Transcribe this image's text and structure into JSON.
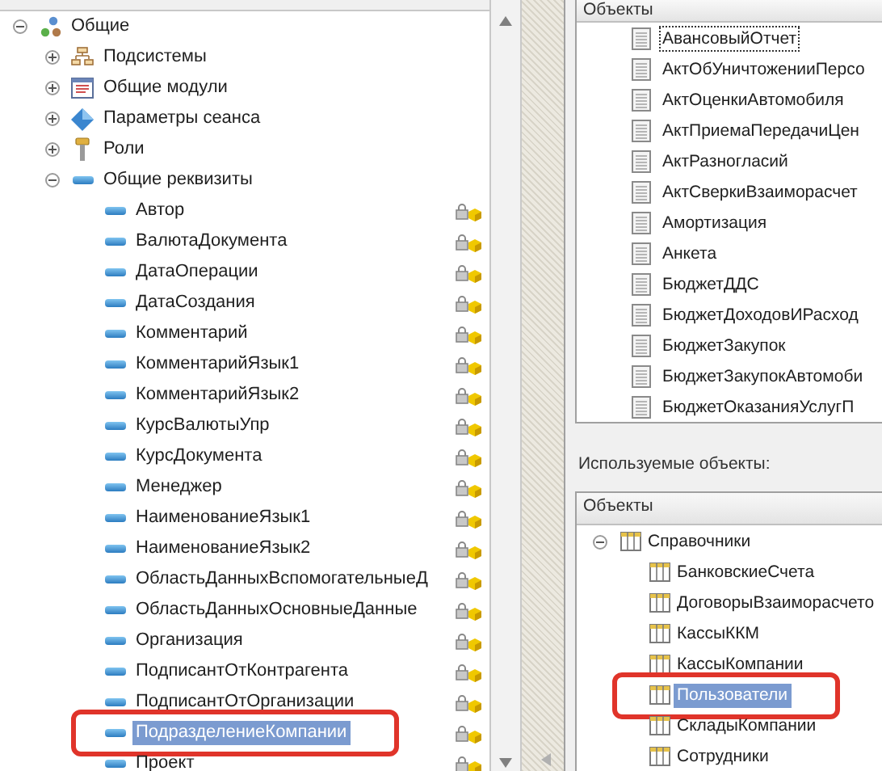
{
  "tree": [
    {
      "label": "Общие",
      "kind": "common",
      "expanded": true,
      "children": [
        {
          "label": "Подсистемы",
          "kind": "subsystems",
          "expanded": false
        },
        {
          "label": "Общие модули",
          "kind": "modules",
          "expanded": false
        },
        {
          "label": "Параметры сеанса",
          "kind": "session_params",
          "expanded": false
        },
        {
          "label": "Роли",
          "kind": "roles",
          "expanded": false
        },
        {
          "label": "Общие реквизиты",
          "kind": "attributes",
          "expanded": true,
          "children": [
            {
              "label": "Автор",
              "kind": "attribute",
              "selected": false,
              "circled": false
            },
            {
              "label": "ВалютаДокумента",
              "kind": "attribute",
              "selected": false,
              "circled": false
            },
            {
              "label": "ДатаОперации",
              "kind": "attribute",
              "selected": false,
              "circled": false
            },
            {
              "label": "ДатаСоздания",
              "kind": "attribute",
              "selected": false,
              "circled": false
            },
            {
              "label": "Комментарий",
              "kind": "attribute",
              "selected": false,
              "circled": false
            },
            {
              "label": "КомментарийЯзык1",
              "kind": "attribute",
              "selected": false,
              "circled": false
            },
            {
              "label": "КомментарийЯзык2",
              "kind": "attribute",
              "selected": false,
              "circled": false
            },
            {
              "label": "КурсВалютыУпр",
              "kind": "attribute",
              "selected": false,
              "circled": false
            },
            {
              "label": "КурсДокумента",
              "kind": "attribute",
              "selected": false,
              "circled": false
            },
            {
              "label": "Менеджер",
              "kind": "attribute",
              "selected": false,
              "circled": false
            },
            {
              "label": "НаименованиеЯзык1",
              "kind": "attribute",
              "selected": false,
              "circled": false
            },
            {
              "label": "НаименованиеЯзык2",
              "kind": "attribute",
              "selected": false,
              "circled": false
            },
            {
              "label": "ОбластьДанныхВспомогательныеД",
              "kind": "attribute",
              "selected": false,
              "circled": false
            },
            {
              "label": "ОбластьДанныхОсновныеДанные",
              "kind": "attribute",
              "selected": false,
              "circled": false
            },
            {
              "label": "Организация",
              "kind": "attribute",
              "selected": false,
              "circled": false
            },
            {
              "label": "ПодписантОтКонтрагента",
              "kind": "attribute",
              "selected": false,
              "circled": false
            },
            {
              "label": "ПодписантОтОрганизации",
              "kind": "attribute",
              "selected": false,
              "circled": false
            },
            {
              "label": "ПодразделениеКомпании",
              "kind": "attribute",
              "selected": true,
              "circled": true
            },
            {
              "label": "Проект",
              "kind": "attribute",
              "selected": false,
              "circled": false
            }
          ]
        }
      ]
    }
  ],
  "objects_panel": {
    "header": "Объекты",
    "items": [
      {
        "label": "АвансовыйОтчет",
        "focused": true
      },
      {
        "label": "АктОбУничтоженииПерсо",
        "focused": false
      },
      {
        "label": "АктОценкиАвтомобиля",
        "focused": false
      },
      {
        "label": "АктПриемаПередачиЦен",
        "focused": false
      },
      {
        "label": "АктРазногласий",
        "focused": false
      },
      {
        "label": "АктСверкиВзаиморасчет",
        "focused": false
      },
      {
        "label": "Амортизация",
        "focused": false
      },
      {
        "label": "Анкета",
        "focused": false
      },
      {
        "label": "БюджетДДС",
        "focused": false
      },
      {
        "label": "БюджетДоходовИРасход",
        "focused": false
      },
      {
        "label": "БюджетЗакупок",
        "focused": false
      },
      {
        "label": "БюджетЗакупокАвтомоби",
        "focused": false
      },
      {
        "label": "БюджетОказанияУслугП",
        "focused": false
      }
    ]
  },
  "used_objects_label": "Используемые объекты:",
  "used_objects_panel": {
    "header": "Объекты",
    "tree": [
      {
        "label": "Справочники",
        "expanded": true,
        "children": [
          {
            "label": "БанковскиеСчета",
            "selected": false,
            "circled": false
          },
          {
            "label": "ДоговорыВзаиморасчето",
            "selected": false,
            "circled": false
          },
          {
            "label": "КассыККМ",
            "selected": false,
            "circled": false
          },
          {
            "label": "КассыКомпании",
            "selected": false,
            "circled": false
          },
          {
            "label": "Пользователи",
            "selected": true,
            "circled": true
          },
          {
            "label": "СкладыКомпании",
            "selected": false,
            "circled": false
          },
          {
            "label": "Сотрудники",
            "selected": false,
            "circled": false
          }
        ]
      }
    ]
  }
}
